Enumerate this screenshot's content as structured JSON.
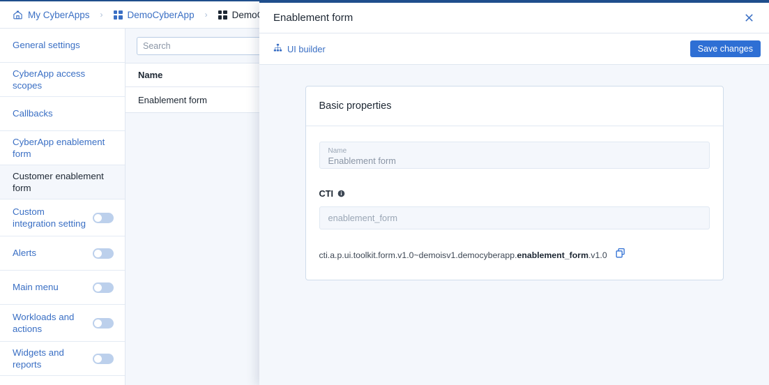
{
  "breadcrumb": {
    "items": [
      {
        "label": "My CyberApps",
        "icon": "home-icon",
        "current": false
      },
      {
        "label": "DemoCyberApp",
        "icon": "grid-icon",
        "current": false
      },
      {
        "label": "DemoCyb",
        "icon": "grid-icon",
        "current": true
      }
    ],
    "separator": "›"
  },
  "sidebar": {
    "items": [
      {
        "label": "General settings",
        "toggle": false,
        "selected": false
      },
      {
        "label": "CyberApp access scopes",
        "toggle": false,
        "selected": false
      },
      {
        "label": "Callbacks",
        "toggle": false,
        "selected": false
      },
      {
        "label": "CyberApp enablement form",
        "toggle": false,
        "selected": false
      },
      {
        "label": "Customer enablement form",
        "toggle": false,
        "selected": true
      },
      {
        "label": "Custom integration setting",
        "toggle": true,
        "selected": false
      },
      {
        "label": "Alerts",
        "toggle": true,
        "selected": false
      },
      {
        "label": "Main menu",
        "toggle": true,
        "selected": false
      },
      {
        "label": "Workloads and actions",
        "toggle": true,
        "selected": false
      },
      {
        "label": "Widgets and reports",
        "toggle": true,
        "selected": false
      }
    ]
  },
  "list": {
    "search": {
      "placeholder": "Search",
      "value": "",
      "icon": "search-icon"
    },
    "column_header": "Name",
    "rows": [
      {
        "name": "Enablement form"
      }
    ]
  },
  "panel": {
    "title": "Enablement form",
    "close_icon": "close-icon",
    "toolbar": {
      "ui_builder_label": "UI builder",
      "ui_builder_icon": "sitemap-icon",
      "save_label": "Save changes"
    },
    "card": {
      "title": "Basic properties",
      "name_field": {
        "label": "Name",
        "value": "Enablement form"
      },
      "cti_field": {
        "label": "CTI",
        "info_icon": "info-icon",
        "placeholder": "enablement_form",
        "value": ""
      },
      "cti_path": {
        "prefix": "cti.a.p.ui.toolkit.form.v1.0~demoisv1.democyberapp.",
        "highlight": "enablement_form",
        "suffix": ".v1.0",
        "copy_icon": "copy-icon"
      }
    }
  },
  "colors": {
    "accent": "#2e6fd4",
    "link": "#3a6fc4",
    "topbar": "#1f4e8c",
    "page_bg": "#f4f7fc",
    "border": "#dfe6f0"
  }
}
